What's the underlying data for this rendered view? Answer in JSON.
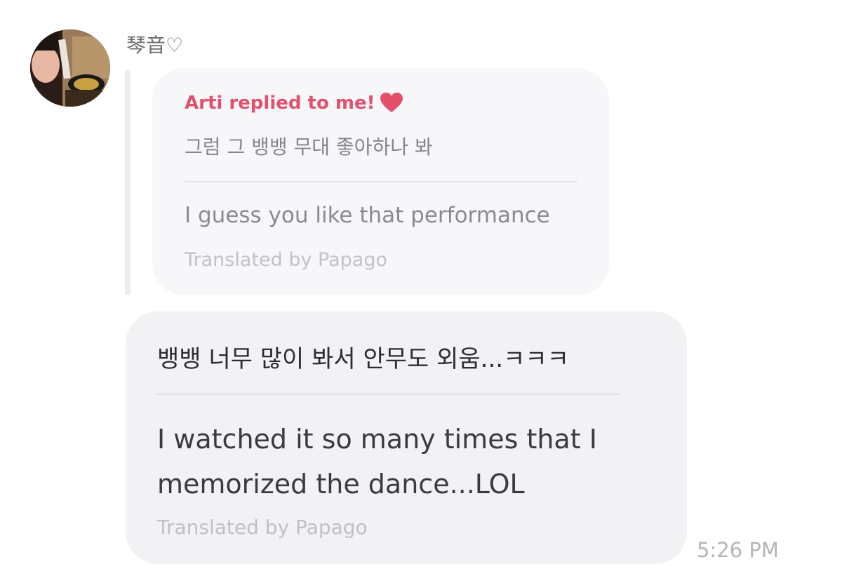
{
  "sender": {
    "name": "琴音♡"
  },
  "quoted_reply": {
    "header": "Arti replied to me!",
    "header_icon": "heart-icon",
    "original_text": "그럼 그 뱅뱅 무대 좋아하나 봐",
    "translated_text": "I guess you like that performance",
    "credit": "Translated by Papago"
  },
  "message": {
    "original_text": "뱅뱅 너무 많이 봐서 안무도 외움...ㅋㅋㅋ",
    "translated_text": "I watched it so many times that I memorized the dance...LOL",
    "credit": "Translated by Papago",
    "timestamp": "5:26 PM"
  },
  "colors": {
    "accent": "#e3506c",
    "bubble": "#f2f2f5",
    "quote_bubble": "#f7f7f9"
  }
}
